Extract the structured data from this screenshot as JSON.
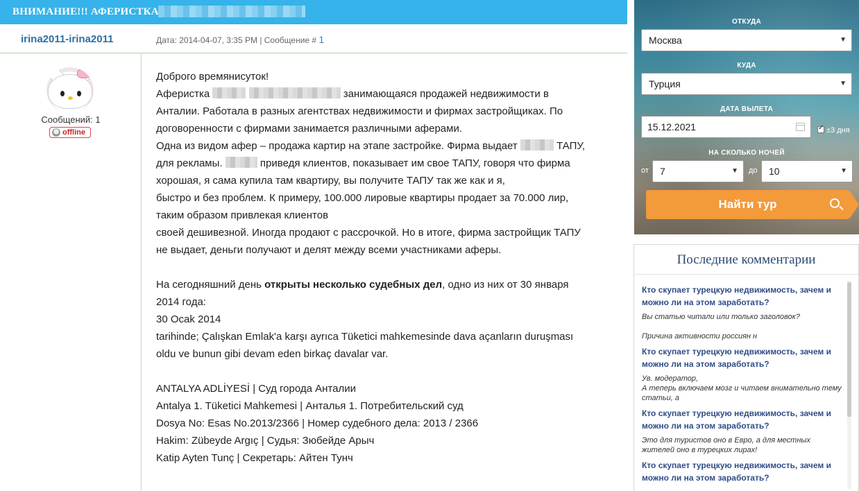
{
  "thread": {
    "title": "ВНИМАНИЕ!!! АФЕРИСТКА"
  },
  "post": {
    "author": "irina2011-irina2011",
    "meta_prefix": "Дата: 2014-04-07, 3:35 PM | Сообщение #",
    "message_number": "1",
    "posts_count": "Сообщений: 1",
    "status": "offline",
    "lines": {
      "l1": "Доброго времянисуток!",
      "l2a": "Аферистка",
      "l2b": "занимающаяся продажей недвижимости в",
      "l3": "Анталии. Работала в разных агентствах недвижимости и фирмах застройщиках. По",
      "l4": "договоренности с фирмами занимается различными аферами.",
      "l5a": "Одна из видом афер – продажа картир на этапе застройке. Фирма выдает",
      "l5b": "ТАПУ,",
      "l6a": "для рекламы.",
      "l6b": "приведя клиентов, показывает им свое ТАПУ, говоря что фирма",
      "l7": "хорошая, я сама купила там квартиру, вы получите ТАПУ так же как и я,",
      "l8": "быстро и без проблем. К примеру, 100.000 лировые квартиры продает за 70.000 лир,",
      "l9": "таким образом привлекая клиентов",
      "l10": "своей дешивезной. Иногда продают с рассрочкой. Но в итоге, фирма застройщик ТАПУ",
      "l11": "не выдает, деньги получают и делят между всеми участниками аферы.",
      "l12a": "На сегодняшний день ",
      "l12b": "открыты несколько судебных дел",
      "l12c": ", одно из них от 30 января",
      "l13": "2014 года:",
      "l14": "30 Ocak 2014",
      "l15": "tarihinde; Çalışkan Emlak'a karşı ayrıca Tüketici mahkemesinde dava açanların duruşması",
      "l16": "oldu ve bunun gibi devam eden birkaç davalar var.",
      "l17": "ANTALYA ADLİYESİ | Суд города Анталии",
      "l18": "Antalya 1. Tüketici Mahkemesi | Анталья 1. Потребительский суд",
      "l19": "Dosya No: Esas No.2013/2366 | Номер судебного дела: 2013 / 2366",
      "l20": "Hakim: Zübeyde Argıç | Судья: Зюбейде Арыч",
      "l21": "Katip Ayten Tunç | Секретарь: Айтен Тунч"
    }
  },
  "search": {
    "from_label": "ОТКУДА",
    "from_value": "Москва",
    "to_label": "КУДА",
    "to_value": "Турция",
    "date_label": "ДАТА ВЫЛЕТА",
    "date_value": "15.12.2021",
    "flex_label": "±3 дня",
    "nights_label": "НА СКОЛЬКО НОЧЕЙ",
    "nights_from_label": "от",
    "nights_from_value": "7",
    "nights_to_label": "до",
    "nights_to_value": "10",
    "button": "Найти тур"
  },
  "comments": {
    "title": "Последние комментарии",
    "items": [
      {
        "link": "Кто скупает турецкую недвижимость, зачем и можно ли на этом заработать?",
        "quote": "Вы статью читали или только заголовок?\n\nПричина активности россиян н"
      },
      {
        "link": "Кто скупает турецкую недвижимость, зачем и можно ли на этом заработать?",
        "quote": "Ув. модератор,\nА теперь включаем мозг и читаем внимательно тему статьи, а"
      },
      {
        "link": "Кто скупает турецкую недвижимость, зачем и можно ли на этом заработать?",
        "quote": "Это для туристов оно в Евро, а для местных жителей оно в турецких лирах!"
      },
      {
        "link": "Кто скупает турецкую недвижимость, зачем и можно ли на этом заработать?",
        "quote": ""
      }
    ]
  },
  "colors": {
    "thread_bar": "#35b3ea",
    "author": "#2f6ea4",
    "button": "#f39a3b",
    "comment_link": "#2f4d86"
  }
}
